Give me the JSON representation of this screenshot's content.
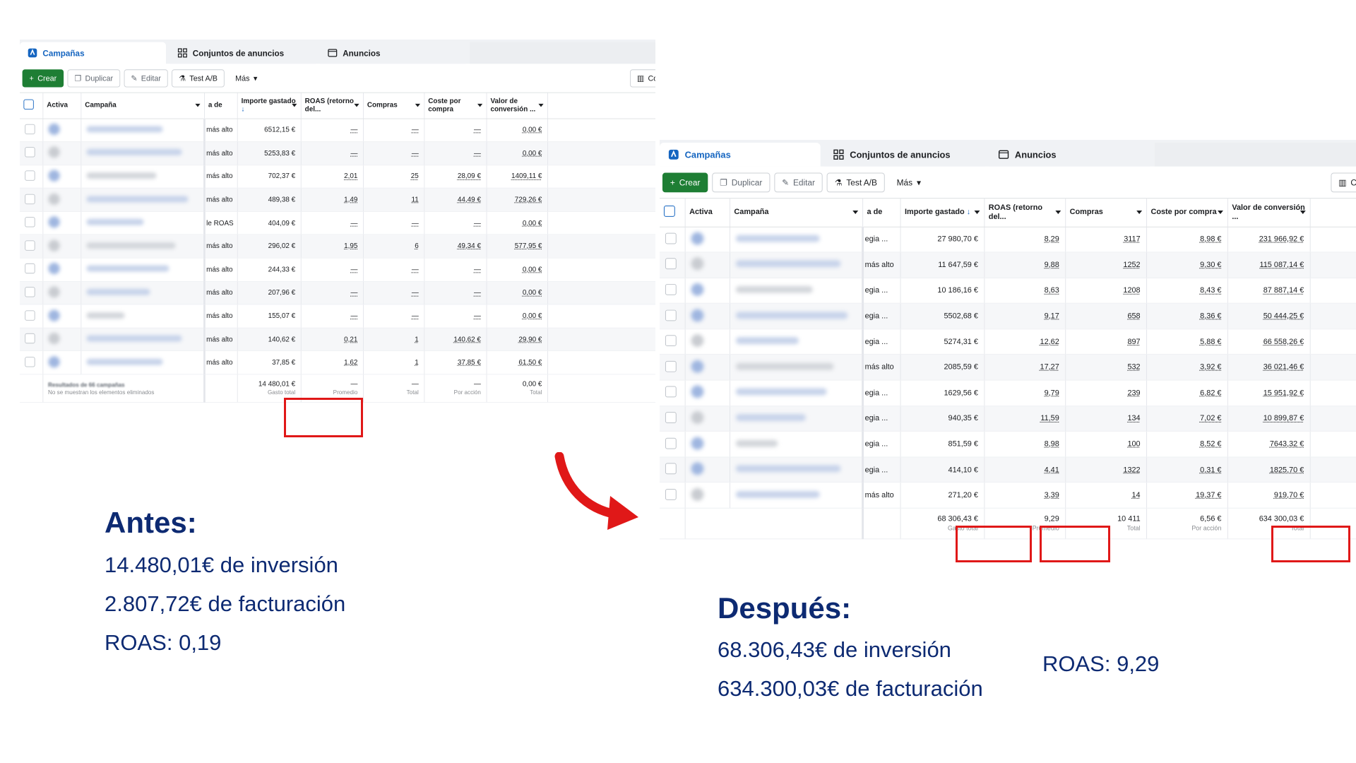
{
  "tabs": [
    {
      "label": "Campañas",
      "icon": "campaign-icon"
    },
    {
      "label": "Conjuntos de anuncios",
      "icon": "grid-icon"
    },
    {
      "label": "Anuncios",
      "icon": "ad-icon"
    }
  ],
  "toolbar": {
    "create": "Crear",
    "duplicate": "Duplicar",
    "edit": "Editar",
    "ab_test": "Test A/B",
    "more": "Más",
    "columns": "Colum"
  },
  "columns": {
    "active": "Activa",
    "campaign": "Campaña",
    "strategy": "a de",
    "spend": "Importe gastado",
    "roas": "ROAS (retorno del...",
    "purchases": "Compras",
    "cpp": "Coste por compra",
    "conv_value": "Valor de conversión ..."
  },
  "before": {
    "rows": [
      {
        "status": "más alto",
        "spend": "6512,15 €",
        "roas": "—",
        "purchases": "—",
        "cpp": "—",
        "value": "0,00 €"
      },
      {
        "status": "más alto",
        "spend": "5253,83 €",
        "roas": "—",
        "purchases": "—",
        "cpp": "—",
        "value": "0,00 €"
      },
      {
        "status": "más alto",
        "spend": "702,37 €",
        "roas": "2,01",
        "purchases": "25",
        "cpp": "28,09 €",
        "value": "1409,11 €"
      },
      {
        "status": "más alto",
        "spend": "489,38 €",
        "roas": "1,49",
        "purchases": "11",
        "cpp": "44,49 €",
        "value": "729,26 €"
      },
      {
        "status": "le ROAS",
        "spend": "404,09 €",
        "roas": "—",
        "purchases": "—",
        "cpp": "—",
        "value": "0,00 €"
      },
      {
        "status": "más alto",
        "spend": "296,02 €",
        "roas": "1,95",
        "purchases": "6",
        "cpp": "49,34 €",
        "value": "577,95 €"
      },
      {
        "status": "más alto",
        "spend": "244,33 €",
        "roas": "—",
        "purchases": "—",
        "cpp": "—",
        "value": "0,00 €"
      },
      {
        "status": "más alto",
        "spend": "207,96 €",
        "roas": "—",
        "purchases": "—",
        "cpp": "—",
        "value": "0,00 €"
      },
      {
        "status": "más alto",
        "spend": "155,07 €",
        "roas": "—",
        "purchases": "—",
        "cpp": "—",
        "value": "0,00 €"
      },
      {
        "status": "más alto",
        "spend": "140,62 €",
        "roas": "0,21",
        "purchases": "1",
        "cpp": "140,62 €",
        "value": "29,90 €"
      },
      {
        "status": "más alto",
        "spend": "37,85 €",
        "roas": "1,62",
        "purchases": "1",
        "cpp": "37,85 €",
        "value": "61,50 €"
      }
    ],
    "footer": {
      "note_top": "Resultados de 66 campañas",
      "note": "No se muestran los elementos eliminados",
      "spend": "14 480,01 €",
      "spend_sub": "Gasto total",
      "roas": "—",
      "roas_sub": "Promedio",
      "purchases": "—",
      "purchases_sub": "Total",
      "cpp": "—",
      "cpp_sub": "Por acción",
      "value": "0,00 €",
      "value_sub": "Total"
    }
  },
  "after": {
    "rows": [
      {
        "status": "egia ...",
        "spend": "27 980,70 €",
        "roas": "8,29",
        "purchases": "3117",
        "cpp": "8,98 €",
        "value": "231 966,92 €"
      },
      {
        "status": "más alto",
        "spend": "11 647,59 €",
        "roas": "9,88",
        "purchases": "1252",
        "cpp": "9,30 €",
        "value": "115 087,14 €"
      },
      {
        "status": "egia ...",
        "spend": "10 186,16 €",
        "roas": "8,63",
        "purchases": "1208",
        "cpp": "8,43 €",
        "value": "87 887,14 €"
      },
      {
        "status": "egia ...",
        "spend": "5502,68 €",
        "roas": "9,17",
        "purchases": "658",
        "cpp": "8,36 €",
        "value": "50 444,25 €"
      },
      {
        "status": "egia ...",
        "spend": "5274,31 €",
        "roas": "12,62",
        "purchases": "897",
        "cpp": "5,88 €",
        "value": "66 558,26 €"
      },
      {
        "status": "más alto",
        "spend": "2085,59 €",
        "roas": "17,27",
        "purchases": "532",
        "cpp": "3,92 €",
        "value": "36 021,46 €"
      },
      {
        "status": "egia ...",
        "spend": "1629,56 €",
        "roas": "9,79",
        "purchases": "239",
        "cpp": "6,82 €",
        "value": "15 951,92 €"
      },
      {
        "status": "egia ...",
        "spend": "940,35 €",
        "roas": "11,59",
        "purchases": "134",
        "cpp": "7,02 €",
        "value": "10 899,87 €"
      },
      {
        "status": "egia ...",
        "spend": "851,59 €",
        "roas": "8,98",
        "purchases": "100",
        "cpp": "8,52 €",
        "value": "7643,32 €"
      },
      {
        "status": "egia ...",
        "spend": "414,10 €",
        "roas": "4,41",
        "purchases": "1322",
        "cpp": "0,31 €",
        "value": "1825,70 €"
      },
      {
        "status": "más alto",
        "spend": "271,20 €",
        "roas": "3,39",
        "purchases": "14",
        "cpp": "19,37 €",
        "value": "919,70 €"
      }
    ],
    "footer": {
      "note_top": "",
      "note": "",
      "spend": "68 306,43 €",
      "spend_sub": "Gasto total",
      "roas": "9,29",
      "roas_sub": "Promedio",
      "purchases": "10 411",
      "purchases_sub": "Total",
      "cpp": "6,56 €",
      "cpp_sub": "Por acción",
      "value": "634 300,03 €",
      "value_sub": "Total"
    }
  },
  "captions": {
    "before_title": "Antes:",
    "before_lines": [
      "14.480,01€ de inversión",
      "2.807,72€ de facturación",
      "ROAS: 0,19"
    ],
    "after_title": "Después:",
    "after_lines": [
      "68.306,43€ de inversión",
      "634.300,03€ de facturación"
    ],
    "after_roas": "ROAS: 9,29"
  },
  "colors": {
    "primary": "#1e7e34",
    "link": "#1565c0",
    "highlight": "#e01818",
    "caption": "#0d2a72"
  }
}
